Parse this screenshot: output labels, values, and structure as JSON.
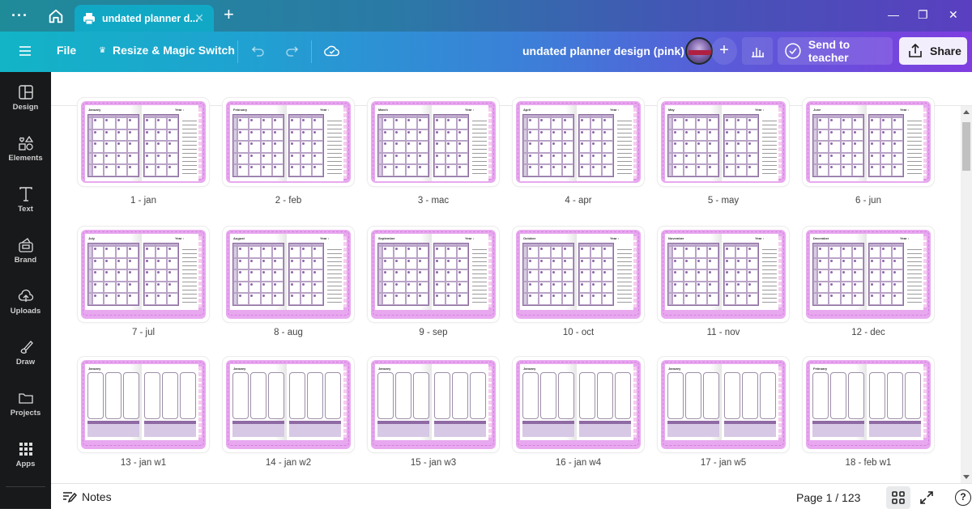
{
  "titlebar": {
    "more_icon": "more-dots-icon",
    "home_icon": "home-icon",
    "tab_title": "undated planner d...",
    "tab_icon": "print-icon",
    "new_tab_label": "+",
    "window_controls": {
      "minimize": "—",
      "restore": "❐",
      "close": "✕"
    }
  },
  "toolbar": {
    "menu_icon": "hamburger-icon",
    "file_label": "File",
    "resize_label": "Resize & Magic Switch",
    "resize_icon": "crown-icon",
    "undo_icon": "undo-icon",
    "redo_icon": "redo-icon",
    "save_status_icon": "cloud-check-icon",
    "document_title": "undated planner design (pink)",
    "add_collaborator_label": "+",
    "insights_icon": "bar-chart-icon",
    "send_to_teacher_label": "Send to teacher",
    "share_label": "Share"
  },
  "sidebar": {
    "items": [
      {
        "label": "Design",
        "icon": "layout-icon"
      },
      {
        "label": "Elements",
        "icon": "shapes-icon"
      },
      {
        "label": "Text",
        "icon": "text-icon"
      },
      {
        "label": "Brand",
        "icon": "brand-kit-icon"
      },
      {
        "label": "Uploads",
        "icon": "cloud-upload-icon"
      },
      {
        "label": "Draw",
        "icon": "pen-icon"
      },
      {
        "label": "Projects",
        "icon": "folder-icon"
      },
      {
        "label": "Apps",
        "icon": "apps-grid-icon"
      }
    ]
  },
  "pages": [
    {
      "label": "1 - jan",
      "kind": "month",
      "title": "January",
      "right_title": "Year :"
    },
    {
      "label": "2 - feb",
      "kind": "month",
      "title": "February",
      "right_title": "Year :"
    },
    {
      "label": "3 - mac",
      "kind": "month",
      "title": "March",
      "right_title": "Year :"
    },
    {
      "label": "4 - apr",
      "kind": "month",
      "title": "April",
      "right_title": "Year :"
    },
    {
      "label": "5 - may",
      "kind": "month",
      "title": "May",
      "right_title": "Year :"
    },
    {
      "label": "6 - jun",
      "kind": "month",
      "title": "June",
      "right_title": "Year :"
    },
    {
      "label": "7 - jul",
      "kind": "month",
      "title": "July",
      "right_title": "Year :"
    },
    {
      "label": "8 - aug",
      "kind": "month",
      "title": "August",
      "right_title": "Year :"
    },
    {
      "label": "9 - sep",
      "kind": "month",
      "title": "September",
      "right_title": "Year :"
    },
    {
      "label": "10 - oct",
      "kind": "month",
      "title": "October",
      "right_title": "Year :"
    },
    {
      "label": "11 - nov",
      "kind": "month",
      "title": "November",
      "right_title": "Year :"
    },
    {
      "label": "12 - dec",
      "kind": "month",
      "title": "December",
      "right_title": "Year :"
    },
    {
      "label": "13 - jan w1",
      "kind": "week",
      "title": "January"
    },
    {
      "label": "14 - jan w2",
      "kind": "week",
      "title": "January"
    },
    {
      "label": "15 - jan w3",
      "kind": "week",
      "title": "January"
    },
    {
      "label": "16 - jan w4",
      "kind": "week",
      "title": "January"
    },
    {
      "label": "17 - jan w5",
      "kind": "week",
      "title": "January"
    },
    {
      "label": "18 - feb w1",
      "kind": "week",
      "title": "February"
    }
  ],
  "footer": {
    "notes_label": "Notes",
    "notes_icon": "notes-icon",
    "page_indicator": "Page 1 / 123",
    "grid_view_icon": "grid-view-icon",
    "fullscreen_icon": "fullscreen-icon",
    "help_label": "?"
  },
  "colors": {
    "frame_pink": "#e8a8ef",
    "grid_purple": "#8a6b9e",
    "sidebar_bg": "#18191b",
    "share_bg": "#f3eefc"
  }
}
